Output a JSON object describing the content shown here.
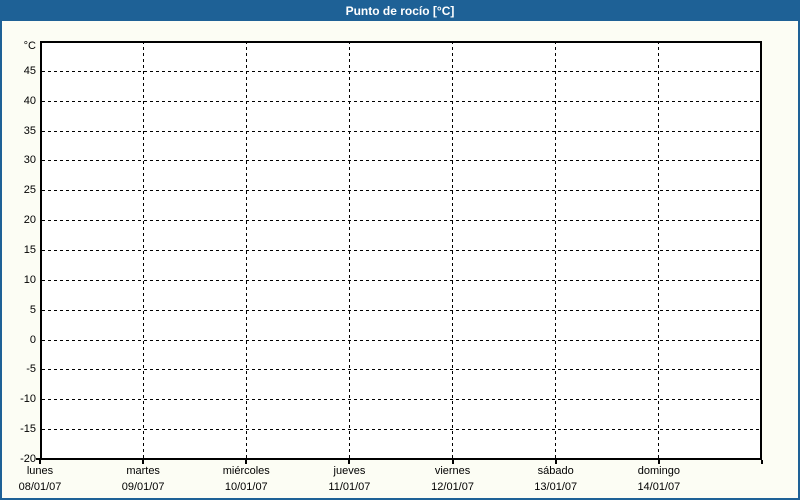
{
  "window": {
    "title": "Punto de rocío [°C]"
  },
  "theme": {
    "titlebar_bg": "#1E6196",
    "border_color": "#1E6196",
    "page_bg": "#FCFDF4",
    "plot_bg": "#FFFFFF",
    "grid_color": "#000000",
    "text_color": "#000000",
    "title_text_color": "#FFFFFF"
  },
  "chart_data": {
    "type": "line",
    "title": "Punto de rocío [°C]",
    "xlabel": "",
    "ylabel": "°C",
    "ylim": [
      -20,
      50
    ],
    "ytick_step": 5,
    "yticks": [
      45,
      40,
      35,
      30,
      25,
      20,
      15,
      10,
      5,
      0,
      -5,
      -10,
      -15,
      -20
    ],
    "x_categories": [
      {
        "day": "lunes",
        "date": "08/01/07"
      },
      {
        "day": "martes",
        "date": "09/01/07"
      },
      {
        "day": "miércoles",
        "date": "10/01/07"
      },
      {
        "day": "jueves",
        "date": "11/01/07"
      },
      {
        "day": "viernes",
        "date": "12/01/07"
      },
      {
        "day": "sábado",
        "date": "13/01/07"
      },
      {
        "day": "domingo",
        "date": "14/01/07"
      }
    ],
    "series": [],
    "grid": {
      "style": "dashed",
      "horizontal": true,
      "vertical": true
    },
    "legend": "none"
  }
}
